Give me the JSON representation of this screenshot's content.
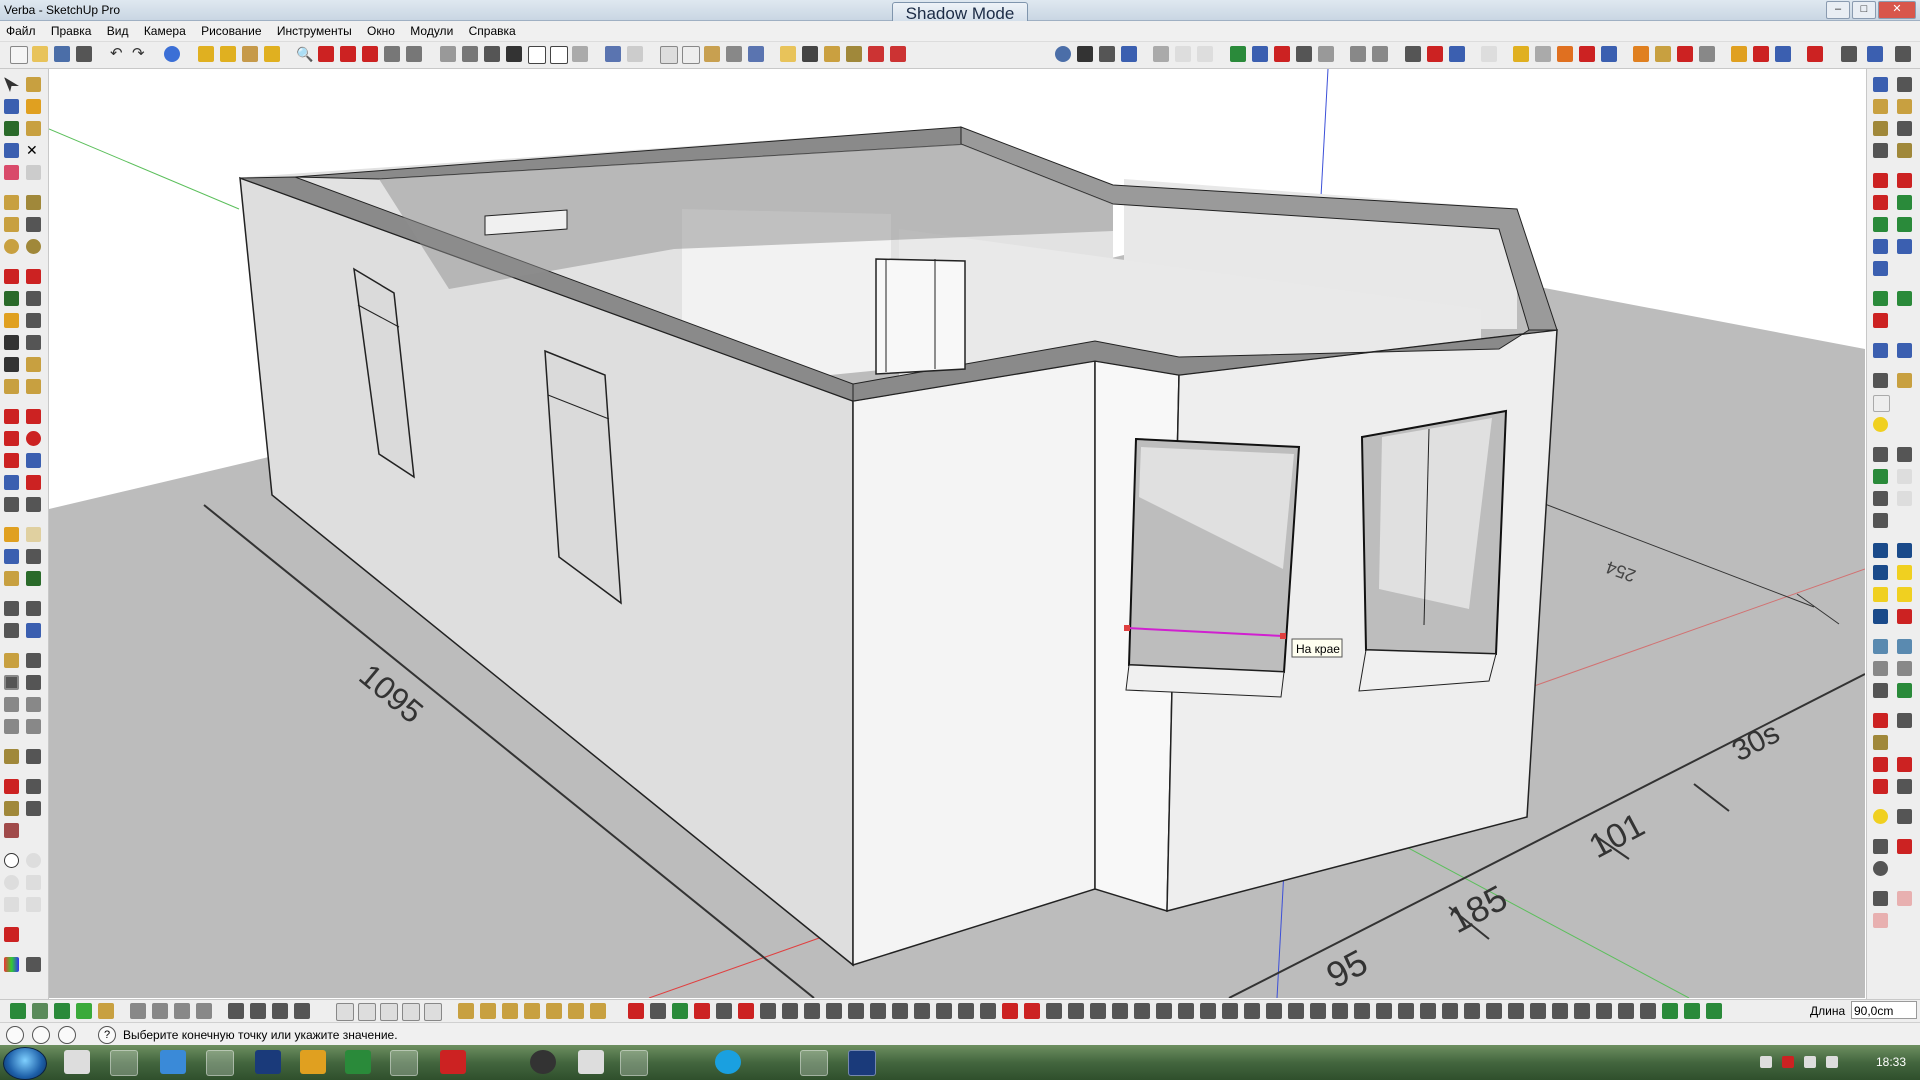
{
  "window": {
    "title": "Verba - SketchUp Pro",
    "shadow_mode_label": "Shadow Mode",
    "minimize": "–",
    "maximize": "□",
    "close": "✕"
  },
  "menu": {
    "items": [
      "Файл",
      "Правка",
      "Вид",
      "Камера",
      "Рисование",
      "Инструменты",
      "Окно",
      "Модули",
      "Справка"
    ]
  },
  "viewport": {
    "tooltip": "На крае",
    "dimensions": [
      "1095",
      "254",
      "30s",
      "101",
      "185",
      "95"
    ]
  },
  "measurements": {
    "label": "Длина",
    "value": "90,0cm"
  },
  "status": {
    "help_icon": "?",
    "message": "Выберите конечную точку или укажите значение."
  },
  "taskbar": {
    "clock": "18:33",
    "apps": [
      "explorer",
      "chrome",
      "ie",
      "folder",
      "photoshop",
      "media",
      "excel",
      "sketchup",
      "winamp",
      "calc",
      "task",
      "network",
      "skype",
      "window",
      "ps-active"
    ]
  },
  "colors": {
    "wall": "#f4f4f4",
    "wall_shade": "#dcdcdc",
    "ground": "#bcbcbc",
    "wall_top": "#8a8a8a",
    "axis_red": "#e04040",
    "axis_green": "#4caf50",
    "axis_blue": "#3c50d8",
    "magenta": "#d020d0"
  }
}
